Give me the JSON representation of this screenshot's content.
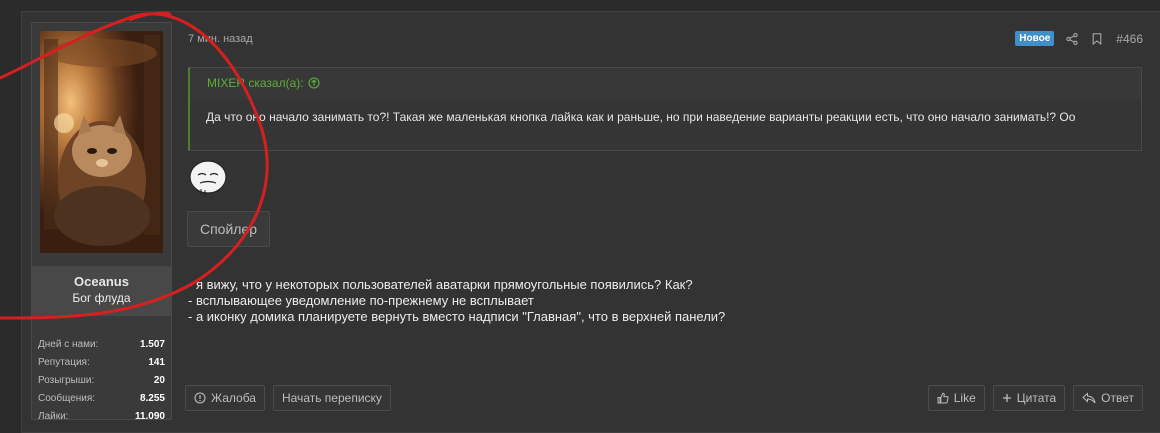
{
  "user": {
    "name": "Oceanus",
    "title": "Бог флуда",
    "stats": [
      {
        "label": "Дней с нами:",
        "value": "1.507"
      },
      {
        "label": "Репутация:",
        "value": "141"
      },
      {
        "label": "Розыгрыши:",
        "value": "20"
      },
      {
        "label": "Сообщения:",
        "value": "8.255"
      },
      {
        "label": "Лайки:",
        "value": "11.090"
      }
    ]
  },
  "post": {
    "time": "7 мин. назад",
    "badge": "Новое",
    "number": "#466",
    "quote": {
      "author": "MIXER сказал(а):",
      "text": "Да что оно начало занимать то?! Такая же маленькая кнопка лайка как и раньше, но при наведение варианты реакции есть, что оно начало занимать!? Оо"
    },
    "spoiler_label": "Спойлер",
    "lines": [
      "- я вижу, что у некоторых пользователей аватарки прямоугольные появились? Как?",
      "- всплывающее уведомление по-прежнему не всплывает",
      "- а иконку домика планируете вернуть вместо надписи \"Главная\", что в верхней панели?"
    ]
  },
  "actions": {
    "report": "Жалоба",
    "message": "Начать переписку",
    "like": "Like",
    "quote": "Цитата",
    "reply": "Ответ"
  },
  "icons": {
    "share": "share-icon",
    "bookmark": "bookmark-icon",
    "report": "alert-circle-icon",
    "like": "thumbs-up-icon",
    "quote": "plus-icon",
    "reply": "reply-icon",
    "expand": "arrow-up-circle-icon"
  },
  "colors": {
    "accent_badge": "#3f8fc9",
    "quote_author": "#5fae3c",
    "annotation": "#d62020"
  }
}
